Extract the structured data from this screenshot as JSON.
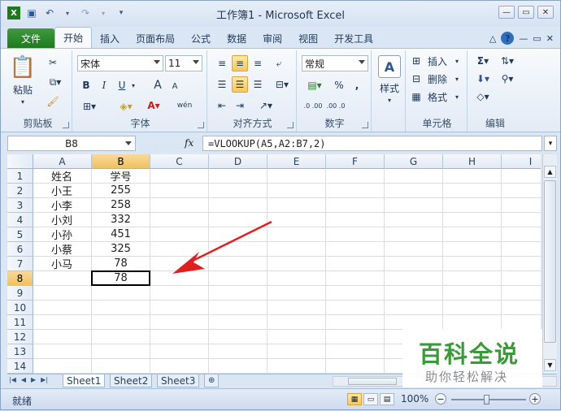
{
  "window": {
    "title": "工作簿1 - Microsoft Excel"
  },
  "ribbon_tabs": [
    "文件",
    "开始",
    "插入",
    "页面布局",
    "公式",
    "数据",
    "审阅",
    "视图",
    "开发工具"
  ],
  "ribbon": {
    "clipboard": {
      "label": "剪贴板",
      "paste": "粘贴"
    },
    "font": {
      "label": "字体",
      "name": "宋体",
      "size": "11",
      "bold": "B",
      "italic": "I",
      "underline": "U",
      "grow": "A",
      "shrink": "A",
      "phonetic": "wén"
    },
    "alignment": {
      "label": "对齐方式"
    },
    "number": {
      "label": "数字",
      "format": "常规",
      "percent": "%",
      "comma": ",",
      "inc_decimal": ".0 .00",
      "dec_decimal": ".00 .0"
    },
    "styles": {
      "label": "样式"
    },
    "cells": {
      "label": "单元格",
      "insert": "插入",
      "delete": "删除",
      "format": "格式"
    },
    "editing": {
      "label": "编辑"
    }
  },
  "formula_bar": {
    "name_box": "B8",
    "fx": "fx",
    "formula": "=VLOOKUP(A5,A2:B7,2)"
  },
  "columns": [
    "A",
    "B",
    "C",
    "D",
    "E",
    "F",
    "G",
    "H",
    "I"
  ],
  "rows": [
    "1",
    "2",
    "3",
    "4",
    "5",
    "6",
    "7",
    "8",
    "9",
    "10",
    "11",
    "12",
    "13",
    "14"
  ],
  "cells": {
    "A1": "姓名",
    "B1": "学号",
    "A2": "小王",
    "B2": "255",
    "A3": "小李",
    "B3": "258",
    "A4": "小刘",
    "B4": "332",
    "A5": "小孙",
    "B5": "451",
    "A6": "小蔡",
    "B6": "325",
    "A7": "小马",
    "B7": "78",
    "B8": "78"
  },
  "sheets": [
    "Sheet1",
    "Sheet2",
    "Sheet3"
  ],
  "status": {
    "ready": "就绪",
    "zoom": "100%"
  },
  "watermark": {
    "title": "百科全说",
    "subtitle": "助你轻松解决"
  },
  "colors": {
    "file_tab": "#1f7a1f",
    "arrow": "#e02020",
    "watermark": "#3a9a3a"
  }
}
